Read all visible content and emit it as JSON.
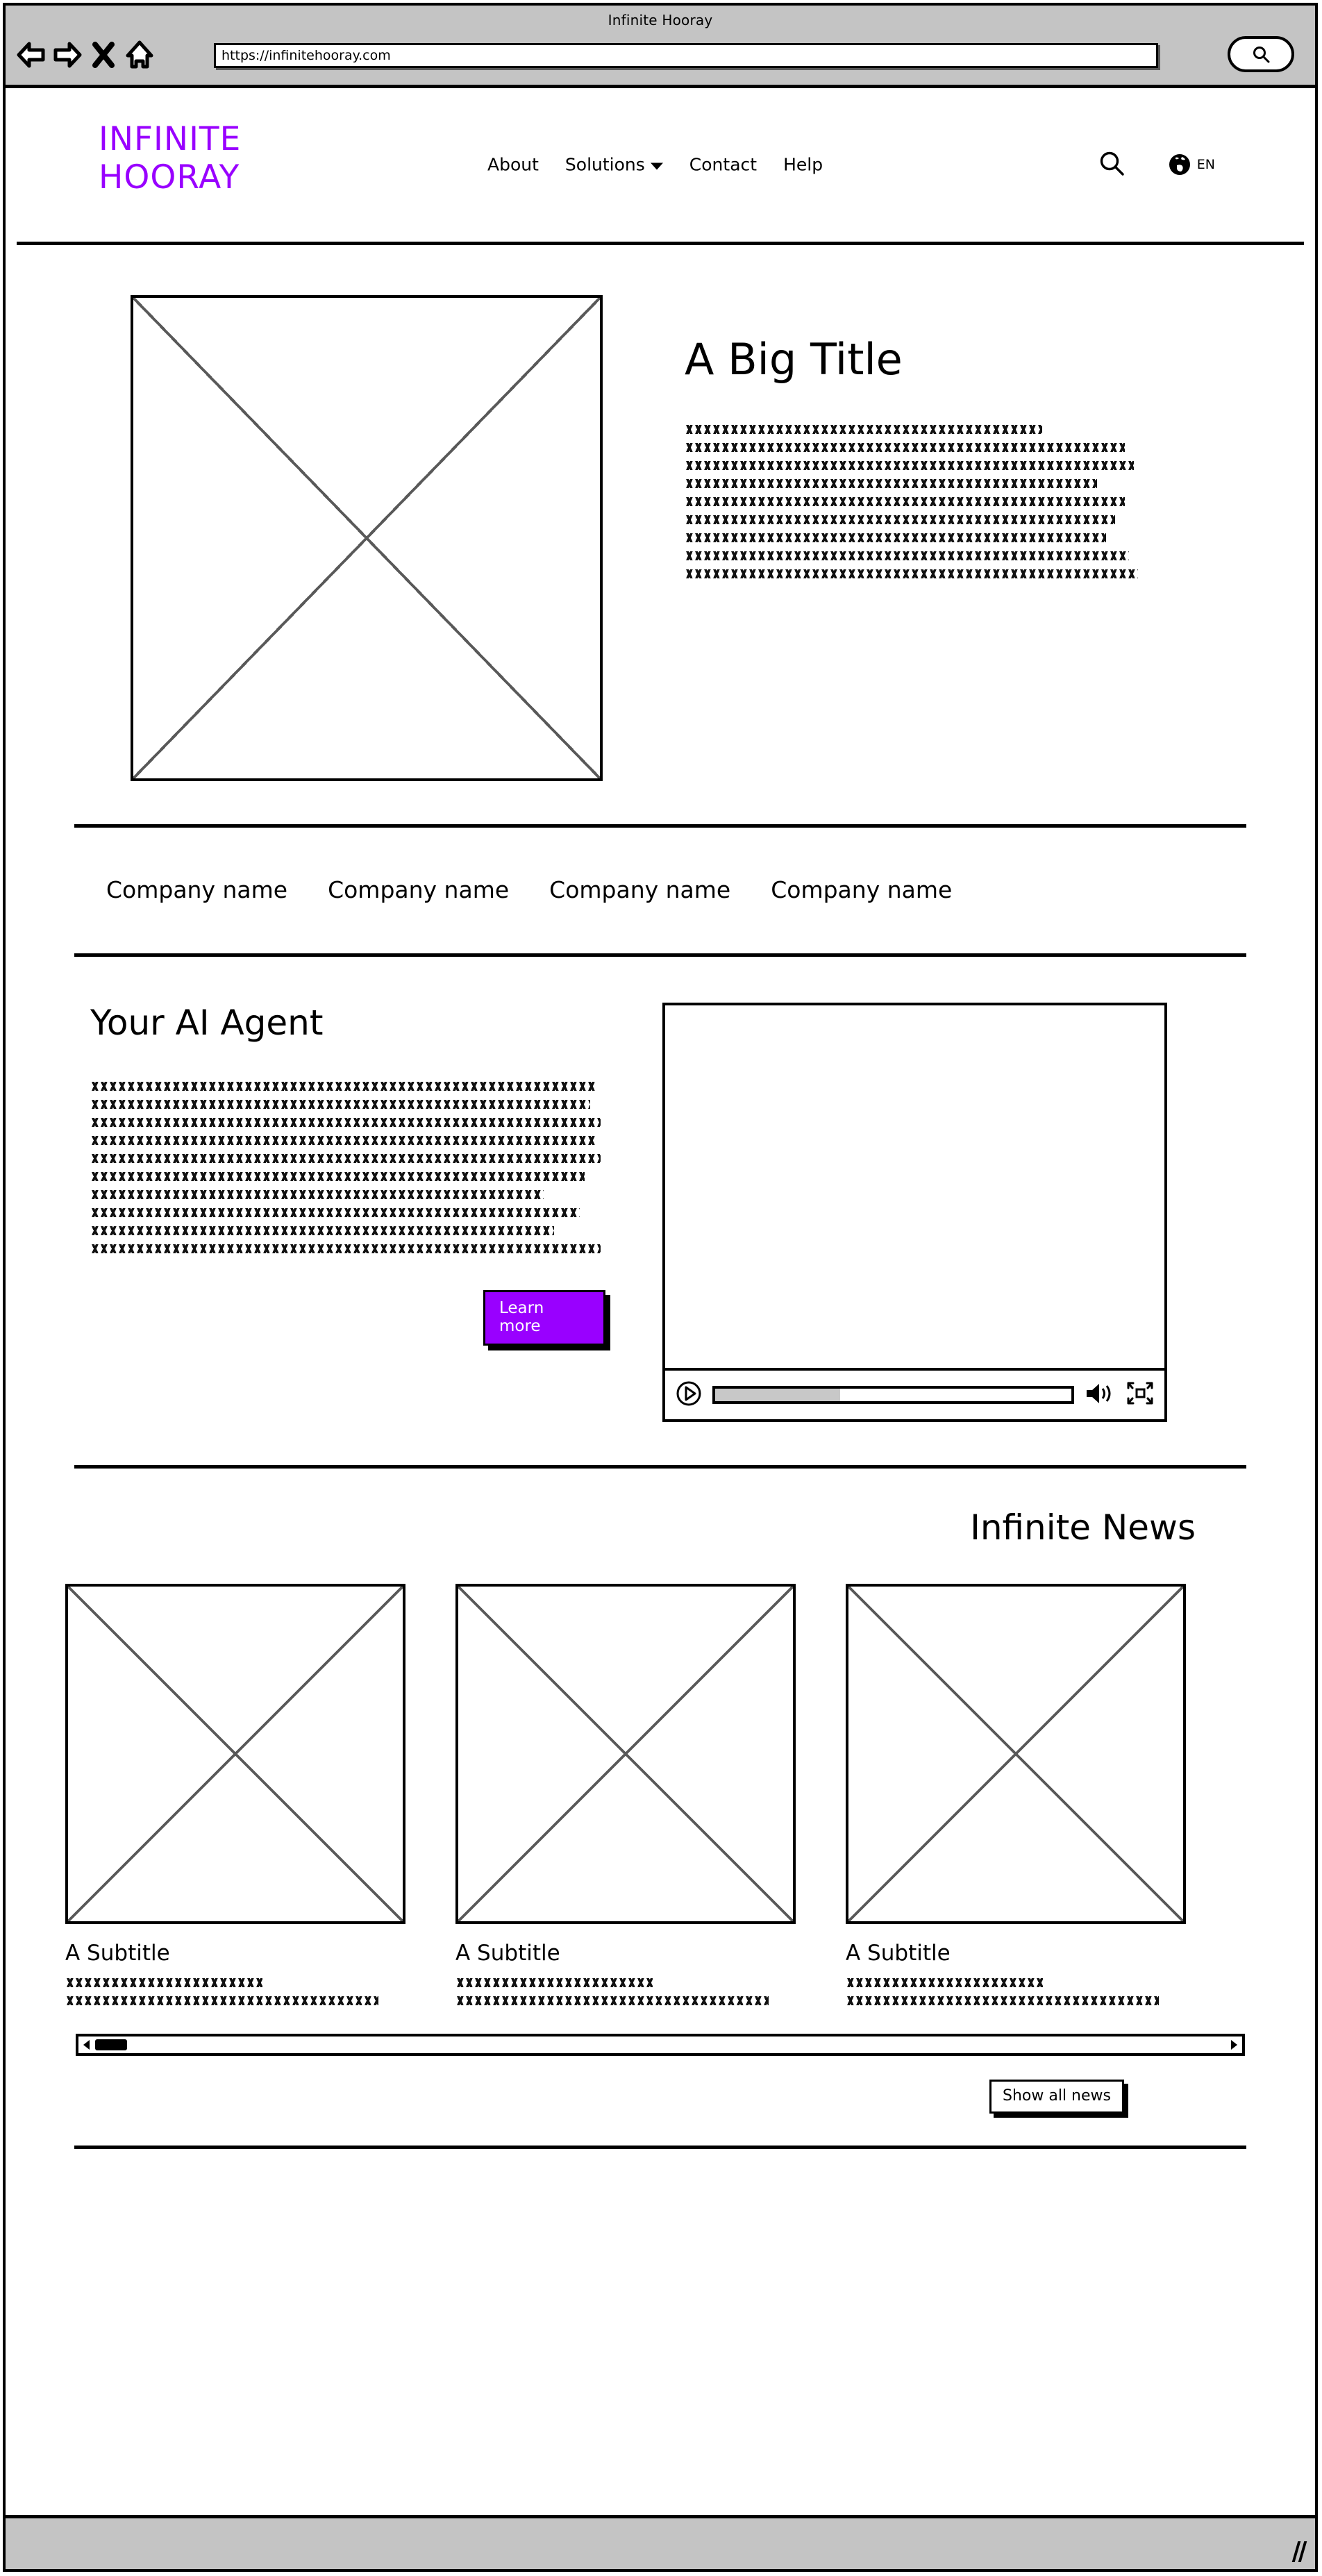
{
  "browser": {
    "window_title": "Infinite Hooray",
    "url": "https://infinitehooray.com",
    "back_icon": "back-arrow-icon",
    "forward_icon": "forward-arrow-icon",
    "stop_icon": "close-x-icon",
    "home_icon": "home-icon",
    "search_icon": "search-icon"
  },
  "header": {
    "logo_line1": "INFINITE",
    "logo_line2": "HOORAY",
    "logo_color": "#9900ff",
    "nav": [
      {
        "label": "About",
        "has_caret": false
      },
      {
        "label": "Solutions",
        "has_caret": true
      },
      {
        "label": "Contact",
        "has_caret": false
      },
      {
        "label": "Help",
        "has_caret": false
      }
    ],
    "search_icon": "search-icon",
    "globe_icon": "globe-icon",
    "language": "EN"
  },
  "hero": {
    "image_alt": "image-placeholder",
    "title": "A Big Title",
    "paragraph_lines": [
      78,
      96,
      98,
      90,
      96,
      94,
      92,
      97,
      99
    ]
  },
  "partners": {
    "items": [
      "Company name",
      "Company name",
      "Company name",
      "Company name"
    ]
  },
  "agent": {
    "title": "Your AI Agent",
    "paragraph_lines": [
      98,
      97,
      99,
      98,
      99,
      96,
      88,
      95,
      90,
      99
    ],
    "cta_label": "Learn more",
    "cta_color": "#9900ff",
    "video": {
      "play_icon": "play-icon",
      "volume_icon": "volume-icon",
      "fullscreen_icon": "fullscreen-icon",
      "progress_percent": 35
    }
  },
  "news": {
    "title": "Infinite News",
    "cards": [
      {
        "subtitle": "A Subtitle",
        "lines": [
          58,
          92
        ]
      },
      {
        "subtitle": "A Subtitle",
        "lines": [
          58,
          92
        ]
      },
      {
        "subtitle": "A Subtitle",
        "lines": [
          58,
          92
        ]
      }
    ],
    "scrollbar": {
      "left_arrow_icon": "chevron-left-icon",
      "right_arrow_icon": "chevron-right-icon",
      "thumb_position_percent": 0
    },
    "show_all_label": "Show all news"
  },
  "status_bar": {
    "resize_grip_icon": "resize-grip-icon"
  }
}
